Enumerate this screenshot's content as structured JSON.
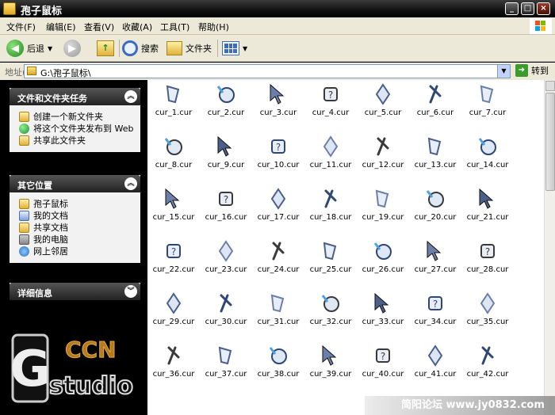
{
  "window": {
    "title": "孢子鼠标",
    "minimize": "_",
    "maximize": "□",
    "close": "×"
  },
  "menu": [
    "文件(F)",
    "编辑(E)",
    "查看(V)",
    "收藏(A)",
    "工具(T)",
    "帮助(H)"
  ],
  "toolbar": {
    "back": "后退",
    "search": "搜索",
    "folders": "文件夹"
  },
  "address": {
    "label": "地址(D)",
    "path": "G:\\孢子鼠标\\",
    "go": "转到"
  },
  "tasks": {
    "title": "文件和文件夹任务",
    "items": [
      {
        "icon": "new-folder-icon",
        "label": "创建一个新文件夹"
      },
      {
        "icon": "web-publish-icon",
        "label": "将这个文件夹发布到 Web"
      },
      {
        "icon": "share-folder-icon",
        "label": "共享此文件夹"
      }
    ]
  },
  "places": {
    "title": "其它位置",
    "items": [
      {
        "icon": "folder-icon",
        "label": "孢子鼠标"
      },
      {
        "icon": "my-documents-icon",
        "label": "我的文档"
      },
      {
        "icon": "shared-documents-icon",
        "label": "共享文档"
      },
      {
        "icon": "my-computer-icon",
        "label": "我的电脑"
      },
      {
        "icon": "network-places-icon",
        "label": "网上邻居"
      }
    ]
  },
  "details": {
    "title": "详细信息"
  },
  "logo": {
    "top": "CCN",
    "bottom": "studio",
    "mark": "G"
  },
  "files": [
    "cur_1.cur",
    "cur_2.cur",
    "cur_3.cur",
    "cur_4.cur",
    "cur_5.cur",
    "cur_6.cur",
    "cur_7.cur",
    "cur_8.cur",
    "cur_9.cur",
    "cur_10.cur",
    "cur_11.cur",
    "cur_12.cur",
    "cur_13.cur",
    "cur_14.cur",
    "cur_15.cur",
    "cur_16.cur",
    "cur_17.cur",
    "cur_18.cur",
    "cur_19.cur",
    "cur_20.cur",
    "cur_21.cur",
    "cur_22.cur",
    "cur_23.cur",
    "cur_24.cur",
    "cur_25.cur",
    "cur_26.cur",
    "cur_27.cur",
    "cur_28.cur",
    "cur_29.cur",
    "cur_30.cur",
    "cur_31.cur",
    "cur_32.cur",
    "cur_33.cur",
    "cur_34.cur",
    "cur_35.cur",
    "cur_36.cur",
    "cur_37.cur",
    "cur_38.cur",
    "cur_39.cur",
    "cur_40.cur",
    "cur_41.cur",
    "cur_42.cur"
  ],
  "watermark": "简阳论坛  www.jy0832.com"
}
